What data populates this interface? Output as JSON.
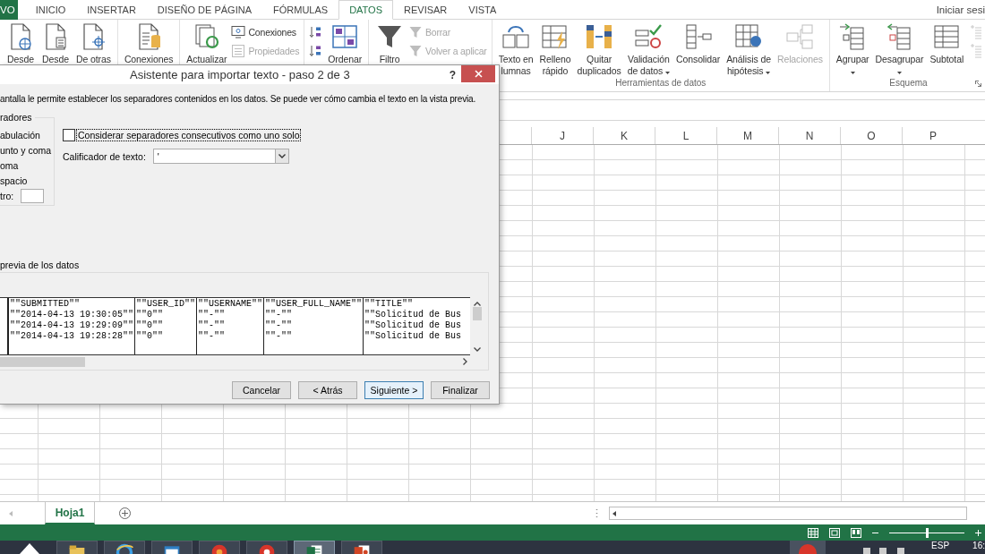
{
  "ribbon_tabs": [
    {
      "label": "VO",
      "kind": "file",
      "selected": false
    },
    {
      "label": "INICIO",
      "kind": "tab",
      "selected": false
    },
    {
      "label": "INSERTAR",
      "kind": "tab",
      "selected": false
    },
    {
      "label": "DISEÑO DE PÁGINA",
      "kind": "tab",
      "selected": false
    },
    {
      "label": "FÓRMULAS",
      "kind": "tab",
      "selected": false
    },
    {
      "label": "DATOS",
      "kind": "tab",
      "selected": true
    },
    {
      "label": "REVISAR",
      "kind": "tab",
      "selected": false
    },
    {
      "label": "VISTA",
      "kind": "tab",
      "selected": false
    }
  ],
  "account": "Iniciar sesi",
  "ribbon": {
    "groups": [
      {
        "items": [
          {
            "kind": "large",
            "lines": [
              "Desde"
            ],
            "disabled": false,
            "dropdown": false
          },
          {
            "kind": "large",
            "lines": [
              "Desde"
            ],
            "disabled": false,
            "dropdown": false
          },
          {
            "kind": "large",
            "lines": [
              "De otras"
            ],
            "disabled": false,
            "dropdown": false
          }
        ]
      },
      {
        "items": [
          {
            "kind": "large",
            "lines": [
              "Conexiones"
            ],
            "disabled": false,
            "dropdown": false
          }
        ]
      },
      {
        "items": [
          {
            "kind": "large",
            "lines": [
              "Actualizar"
            ],
            "disabled": false,
            "dropdown": false
          },
          {
            "kind": "small",
            "lines": [
              "Conexiones"
            ],
            "disabled": false,
            "dropdown": false
          },
          {
            "kind": "small",
            "lines": [
              "Propiedades"
            ],
            "disabled": true,
            "dropdown": false
          }
        ]
      },
      {
        "items": [
          {
            "kind": "icon",
            "disabled": false,
            "dropdown": false
          },
          {
            "kind": "icon",
            "disabled": false,
            "dropdown": false
          },
          {
            "kind": "large",
            "lines": [
              "Ordenar"
            ],
            "disabled": false,
            "dropdown": false
          }
        ]
      },
      {
        "items": [
          {
            "kind": "large",
            "lines": [
              "Filtro"
            ],
            "disabled": false,
            "dropdown": false
          },
          {
            "kind": "small",
            "lines": [
              "Borrar"
            ],
            "disabled": true,
            "dropdown": false
          },
          {
            "kind": "small",
            "lines": [
              "Volver a aplicar"
            ],
            "disabled": true,
            "dropdown": false
          }
        ]
      },
      {
        "label": "Herramientas de datos",
        "items": [
          {
            "kind": "large",
            "lines": [
              "Texto en",
              "lumnas"
            ],
            "disabled": false,
            "dropdown": false
          },
          {
            "kind": "large",
            "lines": [
              "Relleno",
              "rápido"
            ],
            "disabled": false,
            "dropdown": false
          },
          {
            "kind": "large",
            "lines": [
              "Quitar",
              "duplicados"
            ],
            "disabled": false,
            "dropdown": false
          },
          {
            "kind": "large",
            "lines": [
              "Validación",
              "de datos"
            ],
            "disabled": false,
            "dropdown": true
          },
          {
            "kind": "large",
            "lines": [
              "Consolidar"
            ],
            "disabled": false,
            "dropdown": false
          },
          {
            "kind": "large",
            "lines": [
              "Análisis de",
              "hipótesis"
            ],
            "disabled": false,
            "dropdown": true
          },
          {
            "kind": "large",
            "lines": [
              "Relaciones"
            ],
            "disabled": true,
            "dropdown": false
          }
        ]
      },
      {
        "label": "Esquema",
        "items": [
          {
            "kind": "large",
            "lines": [
              "Agrupar"
            ],
            "disabled": false,
            "dropdown": true
          },
          {
            "kind": "large",
            "lines": [
              "Desagrupar"
            ],
            "disabled": false,
            "dropdown": true
          },
          {
            "kind": "large",
            "lines": [
              "Subtotal"
            ],
            "disabled": false,
            "dropdown": false
          },
          {
            "kind": "icon",
            "disabled": true,
            "dropdown": false
          },
          {
            "kind": "icon",
            "disabled": true,
            "dropdown": false
          }
        ]
      }
    ]
  },
  "columns": [
    "J",
    "K",
    "L",
    "M",
    "N",
    "O",
    "P"
  ],
  "dialog": {
    "title": "Asistente para importar texto - paso 2 de 3",
    "help": "?",
    "intro": "antalla le permite establecer los separadores contenidos en los datos. Se puede ver cómo cambia el texto en la vista previa.",
    "separators": {
      "label": "radores",
      "options": [
        {
          "label": "abulación",
          "kind": "option"
        },
        {
          "label": "unto y coma",
          "kind": "option"
        },
        {
          "label": "oma",
          "kind": "option"
        },
        {
          "label": "spacio",
          "kind": "option"
        },
        {
          "label": "tro:",
          "kind": "other"
        }
      ]
    },
    "consecutive": {
      "label": "Considerar separadores consecutivos como uno solo",
      "checked": false,
      "focused": true
    },
    "qualifier": {
      "label": "Calificador de texto:",
      "value": "'"
    },
    "preview": {
      "label": "previa de los datos",
      "rows": [
        [
          "\"\"SUBMITTED\"\"",
          "\"\"USER_ID\"\"",
          "\"\"USERNAME\"\"",
          "\"\"USER_FULL_NAME\"\"",
          "\"\"TITLE\"\""
        ],
        [
          "\"\"2014-04-13 19:30:05\"\"",
          "\"\"0\"\"",
          "\"\"-\"\"",
          "\"\"-\"\"",
          "\"\"Solicitud de Bus"
        ],
        [
          "\"\"2014-04-13 19:29:09\"\"",
          "\"\"0\"\"",
          "\"\"-\"\"",
          "\"\"-\"\"",
          "\"\"Solicitud de Bus"
        ],
        [
          "\"\"2014-04-13 19:28:28\"\"",
          "\"\"0\"\"",
          "\"\"-\"\"",
          "\"\"-\"\"",
          "\"\"Solicitud de Bus"
        ]
      ]
    },
    "buttons": [
      {
        "label": "Cancelar",
        "default": false
      },
      {
        "label": "< Atrás",
        "default": false
      },
      {
        "label": "Siguiente >",
        "default": true
      },
      {
        "label": "Finalizar",
        "default": false
      }
    ]
  },
  "sheet_tabs": [
    {
      "label": "Hoja1",
      "selected": true
    }
  ],
  "status_bar": {
    "zoom": {
      "level": 0.5
    }
  },
  "taskbar": {
    "apps": [
      {
        "selected": false
      },
      {
        "selected": false
      },
      {
        "selected": false
      },
      {
        "selected": false
      },
      {
        "selected": false
      },
      {
        "selected": true
      },
      {
        "selected": false
      }
    ],
    "language": "ESP",
    "clock": "16:"
  }
}
